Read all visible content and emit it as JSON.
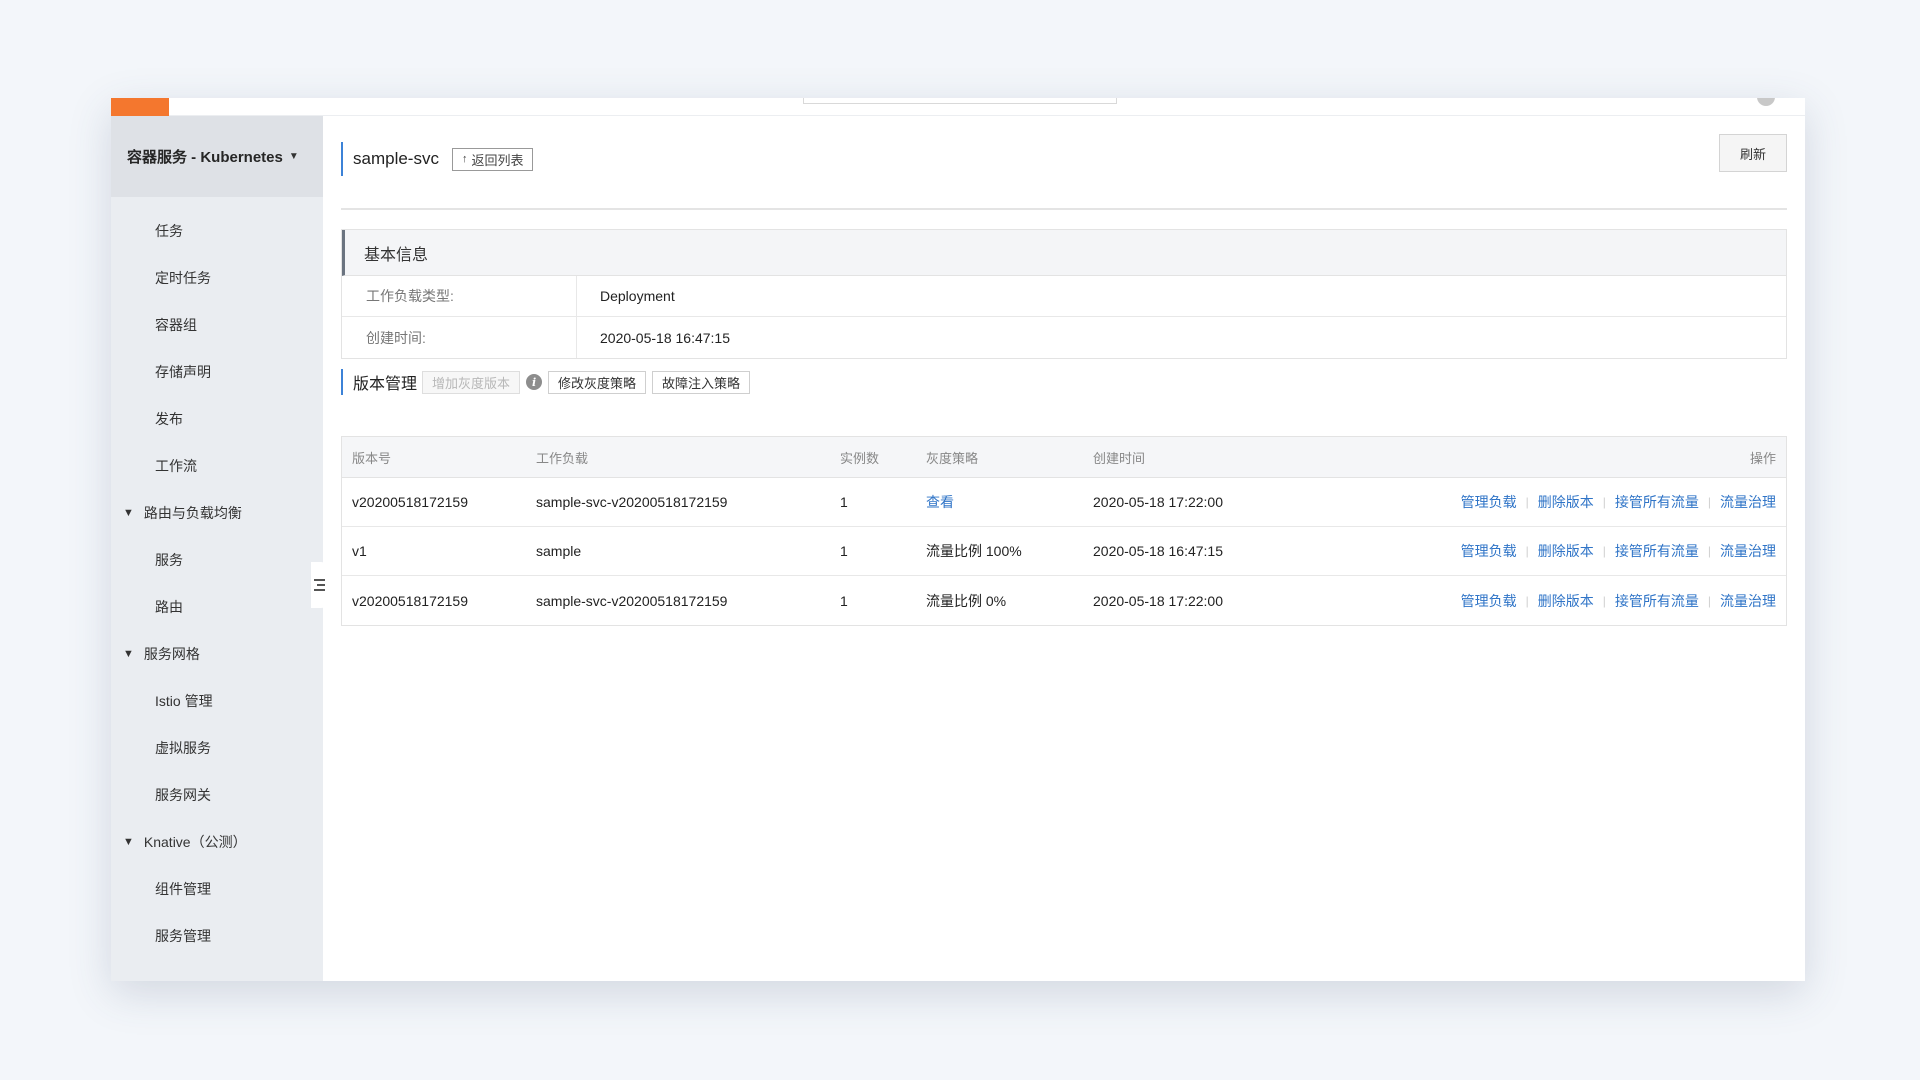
{
  "sidebar": {
    "title": "容器服务 - Kubernetes",
    "items": [
      {
        "label": "任务",
        "type": "sub"
      },
      {
        "label": "定时任务",
        "type": "sub"
      },
      {
        "label": "容器组",
        "type": "sub"
      },
      {
        "label": "存储声明",
        "type": "sub"
      },
      {
        "label": "发布",
        "type": "sub"
      },
      {
        "label": "工作流",
        "type": "sub"
      },
      {
        "label": "路由与负载均衡",
        "type": "group"
      },
      {
        "label": "服务",
        "type": "sub"
      },
      {
        "label": "路由",
        "type": "sub"
      },
      {
        "label": "服务网格",
        "type": "group"
      },
      {
        "label": "Istio 管理",
        "type": "sub"
      },
      {
        "label": "虚拟服务",
        "type": "sub"
      },
      {
        "label": "服务网关",
        "type": "sub"
      },
      {
        "label": "Knative（公测）",
        "type": "group"
      },
      {
        "label": "组件管理",
        "type": "sub"
      },
      {
        "label": "服务管理",
        "type": "sub"
      }
    ]
  },
  "page": {
    "title": "sample-svc",
    "back_label": "返回列表",
    "refresh_label": "刷新"
  },
  "basic_info": {
    "heading": "基本信息",
    "rows": [
      {
        "key": "工作负载类型:",
        "value": "Deployment"
      },
      {
        "key": "创建时间:",
        "value": "2020-05-18 16:47:15"
      }
    ]
  },
  "versions": {
    "heading": "版本管理",
    "add_gray_label": "增加灰度版本",
    "edit_policy_label": "修改灰度策略",
    "fault_label": "故障注入策略",
    "columns": [
      "版本号",
      "工作负载",
      "实例数",
      "灰度策略",
      "创建时间",
      "操作"
    ],
    "actions": [
      "管理负载",
      "删除版本",
      "接管所有流量",
      "流量治理"
    ],
    "rows": [
      {
        "version": "v20200518172159",
        "workload": "sample-svc-v20200518172159",
        "instances": "1",
        "policy": "查看",
        "policy_is_link": true,
        "created": "2020-05-18 17:22:00"
      },
      {
        "version": "v1",
        "workload": "sample",
        "instances": "1",
        "policy": "流量比例 100%",
        "policy_is_link": false,
        "created": "2020-05-18 16:47:15"
      },
      {
        "version": "v20200518172159",
        "workload": "sample-svc-v20200518172159",
        "instances": "1",
        "policy": "流量比例 0%",
        "policy_is_link": false,
        "created": "2020-05-18 17:22:00"
      }
    ]
  },
  "floating": {
    "chat_icon": "chat-icon",
    "blue_glyph": "□◇"
  }
}
